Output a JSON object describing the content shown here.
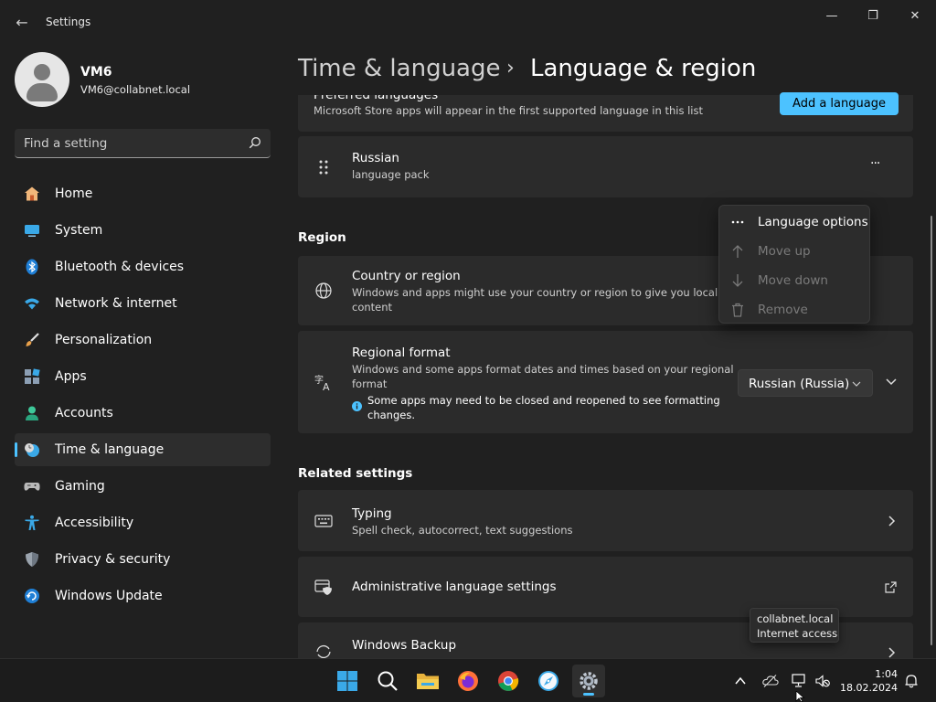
{
  "window": {
    "title": "Settings",
    "minimize_glyph": "—",
    "maximize_glyph": "❐",
    "close_glyph": "✕",
    "back_glyph": "←"
  },
  "profile": {
    "name": "VM6",
    "email": "VM6@collabnet.local"
  },
  "search": {
    "placeholder": "Find a setting"
  },
  "sidebar": {
    "items": [
      {
        "label": "Home",
        "icon": "home-icon"
      },
      {
        "label": "System",
        "icon": "system-icon"
      },
      {
        "label": "Bluetooth & devices",
        "icon": "bluetooth-icon"
      },
      {
        "label": "Network & internet",
        "icon": "wifi-icon"
      },
      {
        "label": "Personalization",
        "icon": "brush-icon"
      },
      {
        "label": "Apps",
        "icon": "apps-icon"
      },
      {
        "label": "Accounts",
        "icon": "accounts-icon"
      },
      {
        "label": "Time & language",
        "icon": "time-language-icon",
        "active": true
      },
      {
        "label": "Gaming",
        "icon": "gamepad-icon"
      },
      {
        "label": "Accessibility",
        "icon": "accessibility-icon"
      },
      {
        "label": "Privacy & security",
        "icon": "shield-icon"
      },
      {
        "label": "Windows Update",
        "icon": "update-icon"
      }
    ]
  },
  "header": {
    "parent": "Time & language",
    "separator": "›",
    "current": "Language & region"
  },
  "preferred_languages": {
    "title": "Preferred languages",
    "desc": "Microsoft Store apps will appear in the first supported language in this list",
    "add_button": "Add a language"
  },
  "language_item": {
    "name": "Russian",
    "desc": "language pack",
    "more_glyph": "···"
  },
  "context_menu": {
    "items": [
      {
        "label": "Language options",
        "icon": "more-icon",
        "enabled": true
      },
      {
        "label": "Move up",
        "icon": "arrow-up-icon",
        "enabled": false
      },
      {
        "label": "Move down",
        "icon": "arrow-down-icon",
        "enabled": false
      },
      {
        "label": "Remove",
        "icon": "trash-icon",
        "enabled": false
      }
    ]
  },
  "region": {
    "section_title": "Region",
    "country": {
      "title": "Country or region",
      "desc_line1": "Windows and apps might use your country or region to give you local",
      "desc_line2": "content"
    },
    "format": {
      "title": "Regional format",
      "desc_line1": "Windows and some apps format dates and times based on your regional",
      "desc_line2": "format",
      "note_line1": "Some apps may need to be closed and reopened to see formatting",
      "note_line2": "changes.",
      "value": "Russian (Russia)"
    }
  },
  "related": {
    "section_title": "Related settings",
    "typing": {
      "title": "Typing",
      "desc": "Spell check, autocorrect, text suggestions"
    },
    "admin": {
      "title": "Administrative language settings"
    },
    "backup": {
      "title": "Windows Backup"
    }
  },
  "tooltip": {
    "line1": "collabnet.local",
    "line2": "Internet access"
  },
  "taskbar": {
    "apps": [
      "start-icon",
      "search-icon",
      "file-explorer-icon",
      "firefox-icon",
      "chrome-icon",
      "safari-like-icon",
      "settings-icon"
    ],
    "time": "1:04",
    "date": "18.02.2024"
  },
  "colors": {
    "accent": "#4cc2ff",
    "background": "#202020",
    "card": "#2b2b2b"
  }
}
